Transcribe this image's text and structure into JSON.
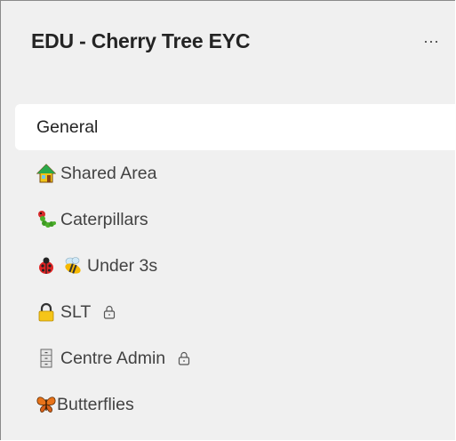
{
  "team": {
    "name": "EDU - Cherry Tree EYC",
    "more_label": "···"
  },
  "channels": [
    {
      "label": "General",
      "selected": true,
      "icons": [],
      "private": false
    },
    {
      "label": "Shared Area",
      "selected": false,
      "icons": [
        "house-emoji-icon"
      ],
      "private": false
    },
    {
      "label": "Caterpillars",
      "selected": false,
      "icons": [
        "caterpillar-emoji-icon"
      ],
      "private": false
    },
    {
      "label": "Under 3s",
      "selected": false,
      "icons": [
        "ladybug-emoji-icon",
        "bee-emoji-icon"
      ],
      "private": false
    },
    {
      "label": "SLT",
      "selected": false,
      "icons": [
        "padlock-emoji-icon"
      ],
      "private": true
    },
    {
      "label": "Centre Admin",
      "selected": false,
      "icons": [
        "filing-cabinet-emoji-icon"
      ],
      "private": true
    },
    {
      "label": "Butterflies",
      "selected": false,
      "icons": [
        "butterfly-emoji-icon"
      ],
      "private": false
    }
  ],
  "colors": {
    "pane_background": "#f0f0f0",
    "selected_background": "#ffffff",
    "text_primary": "#242424",
    "text_secondary": "#424242"
  }
}
